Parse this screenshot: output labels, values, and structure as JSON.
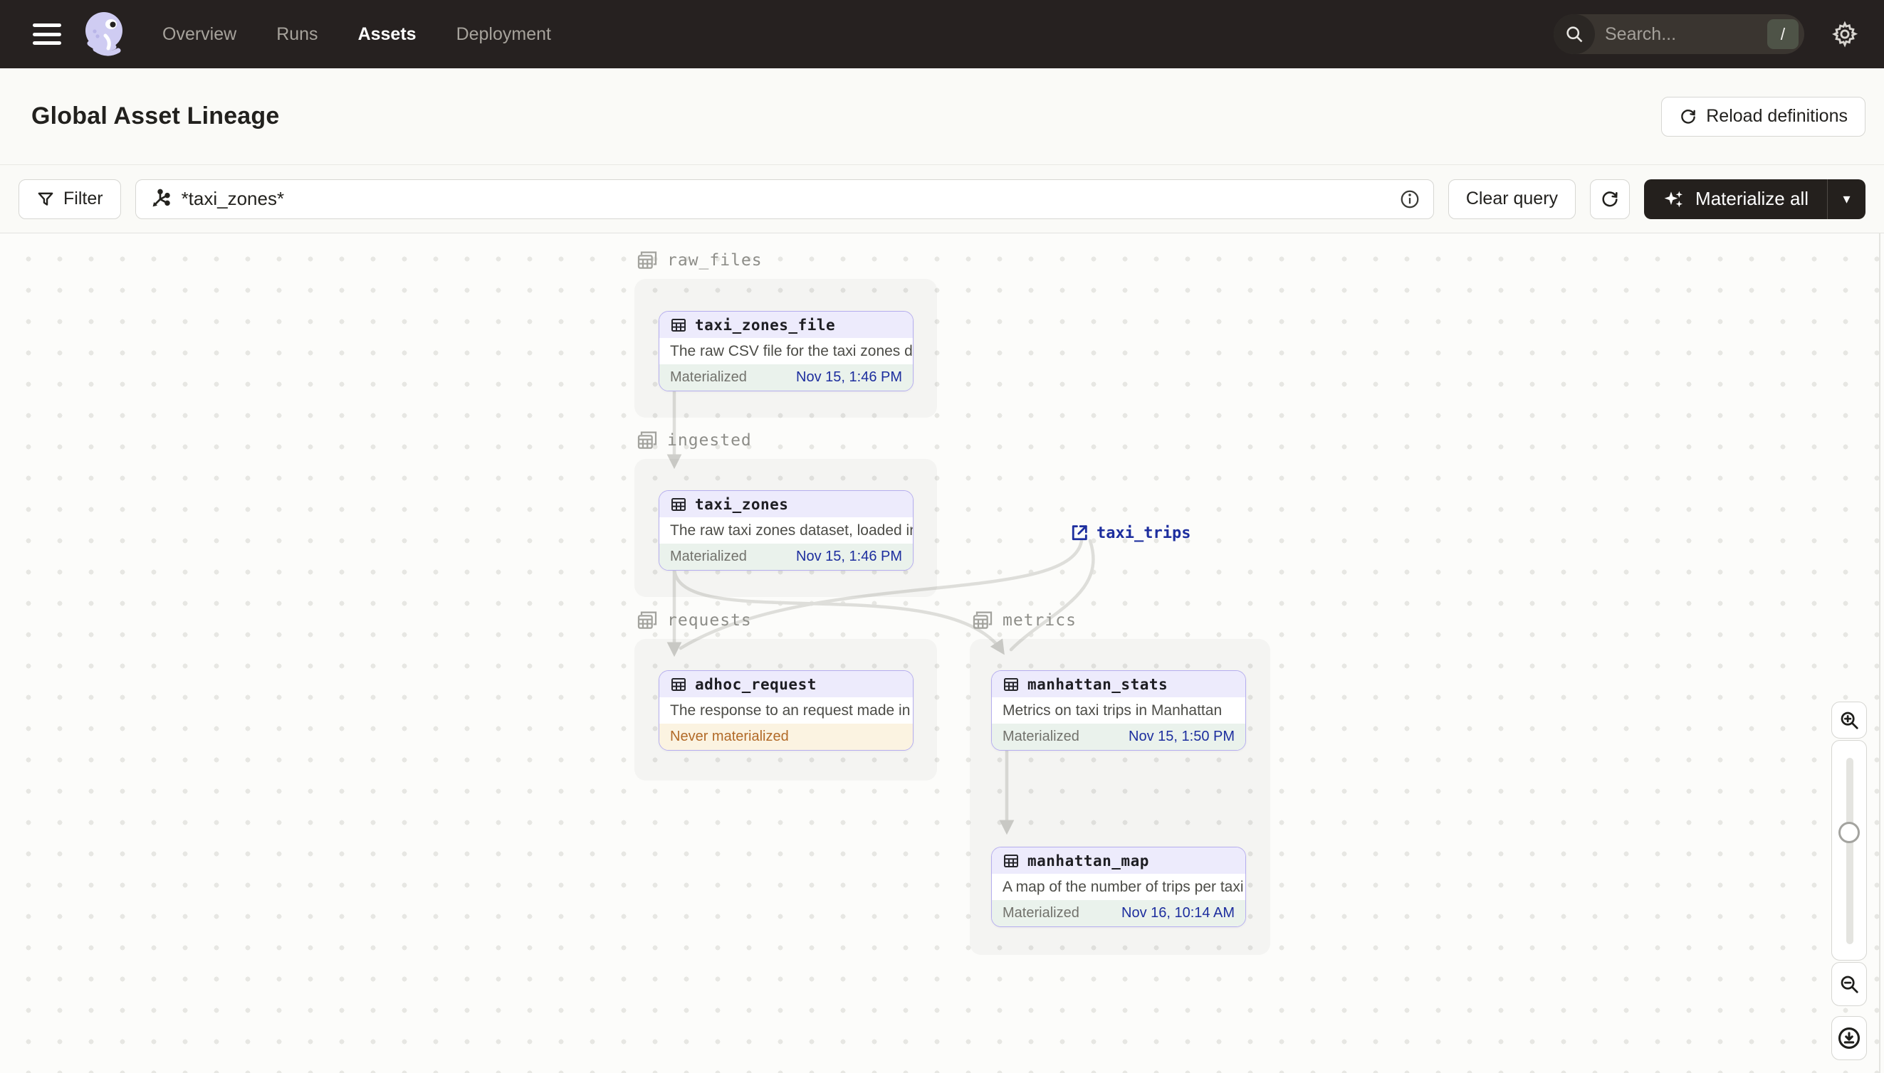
{
  "topbar": {
    "nav": [
      {
        "label": "Overview",
        "active": false
      },
      {
        "label": "Runs",
        "active": false
      },
      {
        "label": "Assets",
        "active": true
      },
      {
        "label": "Deployment",
        "active": false
      }
    ],
    "search": {
      "placeholder": "Search...",
      "shortcut": "/"
    }
  },
  "header": {
    "title": "Global Asset Lineage",
    "reload_label": "Reload definitions"
  },
  "toolbar": {
    "filter_label": "Filter",
    "query_value": "*taxi_zones*",
    "clear_label": "Clear query",
    "materialize_label": "Materialize all",
    "caret": "▾"
  },
  "graph": {
    "groups": [
      {
        "name": "raw_files"
      },
      {
        "name": "ingested"
      },
      {
        "name": "requests"
      },
      {
        "name": "metrics"
      }
    ],
    "nodes": [
      {
        "name": "taxi_zones_file",
        "description": "The raw CSV file for the taxi zones dat...",
        "status": "Materialized",
        "timestamp": "Nov 15, 1:46 PM"
      },
      {
        "name": "taxi_zones",
        "description": "The raw taxi zones dataset, loaded int...",
        "status": "Materialized",
        "timestamp": "Nov 15, 1:46 PM"
      },
      {
        "name": "adhoc_request",
        "description": "The response to an request made in th...",
        "status": "Never materialized",
        "timestamp": ""
      },
      {
        "name": "manhattan_stats",
        "description": "Metrics on taxi trips in Manhattan",
        "status": "Materialized",
        "timestamp": "Nov 15, 1:50 PM"
      },
      {
        "name": "manhattan_map",
        "description": "A map of the number of trips per taxi z...",
        "status": "Materialized",
        "timestamp": "Nov 16, 10:14 AM"
      }
    ],
    "external_node": {
      "name": "taxi_trips"
    }
  },
  "colors": {
    "topbar_bg": "#262120",
    "page_bg": "#FAFAF7",
    "canvas_bg": "#FCFCFA",
    "node_border": "#B5ADEF",
    "node_header_bg": "#EDEBFC",
    "materialized_bg": "#EAF2EC",
    "materialized_time": "#1D2E9E",
    "never_materialized_bg": "#FBF3E1",
    "never_materialized_text": "#B26A28",
    "edge": "#DEDEDA",
    "logo_lavender": "#CFCCF2"
  }
}
